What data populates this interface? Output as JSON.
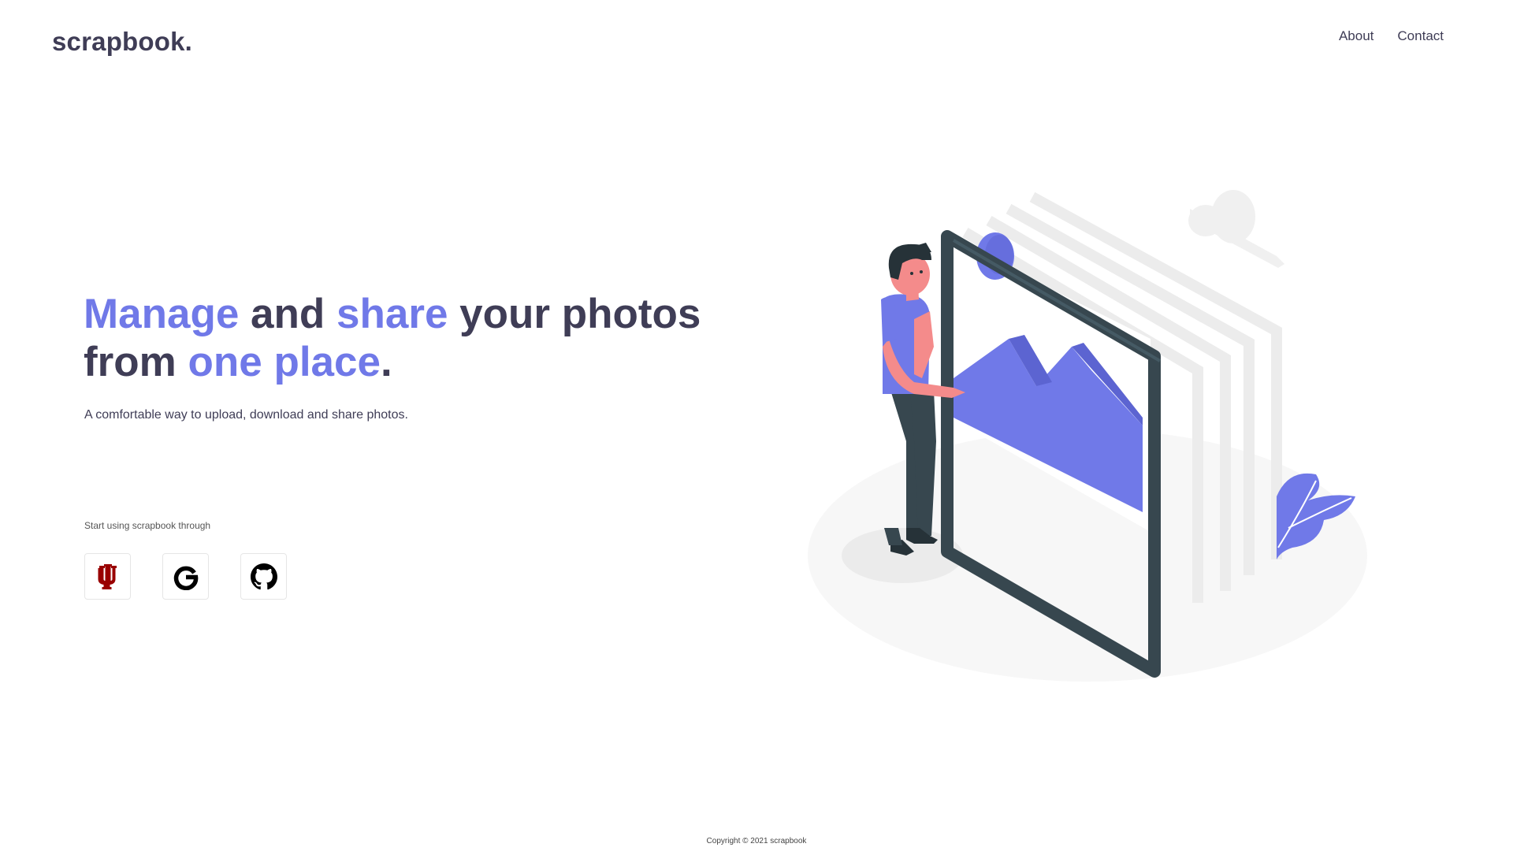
{
  "header": {
    "brand": "scrapbook.",
    "nav": [
      {
        "label": "About"
      },
      {
        "label": "Contact"
      }
    ]
  },
  "hero": {
    "title_parts": [
      {
        "text": "Manage",
        "accent": true
      },
      {
        "text": " and ",
        "accent": false
      },
      {
        "text": "share",
        "accent": true
      },
      {
        "text": " your photos from ",
        "accent": false
      },
      {
        "text": "one place",
        "accent": true
      },
      {
        "text": ".",
        "accent": false
      }
    ],
    "subtitle": "A comfortable way to upload, download and share photos.",
    "start_label": "Start using scrapbook through",
    "providers": [
      {
        "icon": "iu-trident-icon"
      },
      {
        "icon": "google-icon"
      },
      {
        "icon": "github-icon"
      }
    ]
  },
  "footer": {
    "copyright": "Copyright © 2021 scrapbook"
  },
  "colors": {
    "accent": "#7079e8",
    "text_dark": "#3f3d56",
    "iu_red": "#990000",
    "frame_dark": "#37474f"
  }
}
